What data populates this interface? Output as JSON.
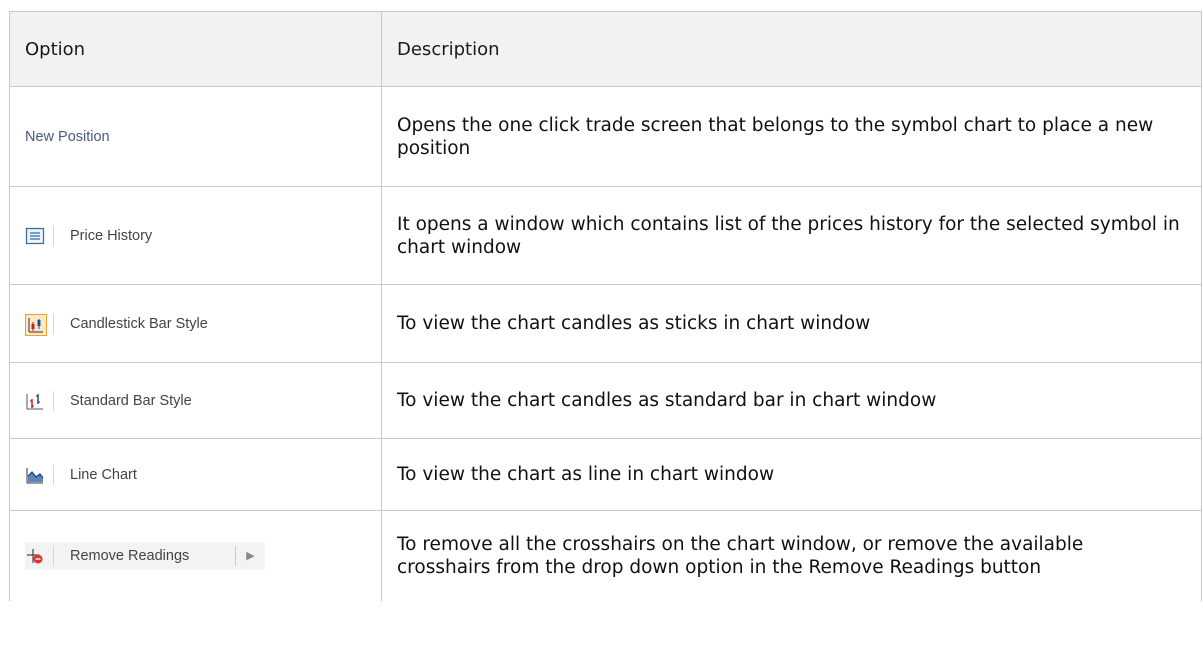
{
  "header": {
    "option": "Option",
    "description": "Description"
  },
  "rows": [
    {
      "option_label": "New Position",
      "icon": "none",
      "description": "Opens the one click trade screen that belongs to the symbol chart to place a new position"
    },
    {
      "option_label": "Price History",
      "icon": "list-window-icon",
      "description": "It opens a window which contains list of the prices history for the selected symbol in chart window"
    },
    {
      "option_label": "Candlestick Bar Style",
      "icon": "candlestick-icon",
      "description": "To view the chart candles as sticks in chart window"
    },
    {
      "option_label": "Standard Bar Style",
      "icon": "bar-chart-icon",
      "description": "To view the chart candles as standard bar in chart window"
    },
    {
      "option_label": "Line Chart",
      "icon": "line-chart-icon",
      "description": "To view the chart as line in chart window"
    },
    {
      "option_label": "Remove Readings",
      "icon": "remove-crosshair-icon",
      "description": "To remove all the crosshairs on the chart window, or remove the available crosshairs from the drop down option in the Remove Readings button"
    }
  ],
  "colors": {
    "accent_orange": "#f0a030",
    "icon_blue": "#3a6ea5",
    "remove_red": "#e03030"
  }
}
